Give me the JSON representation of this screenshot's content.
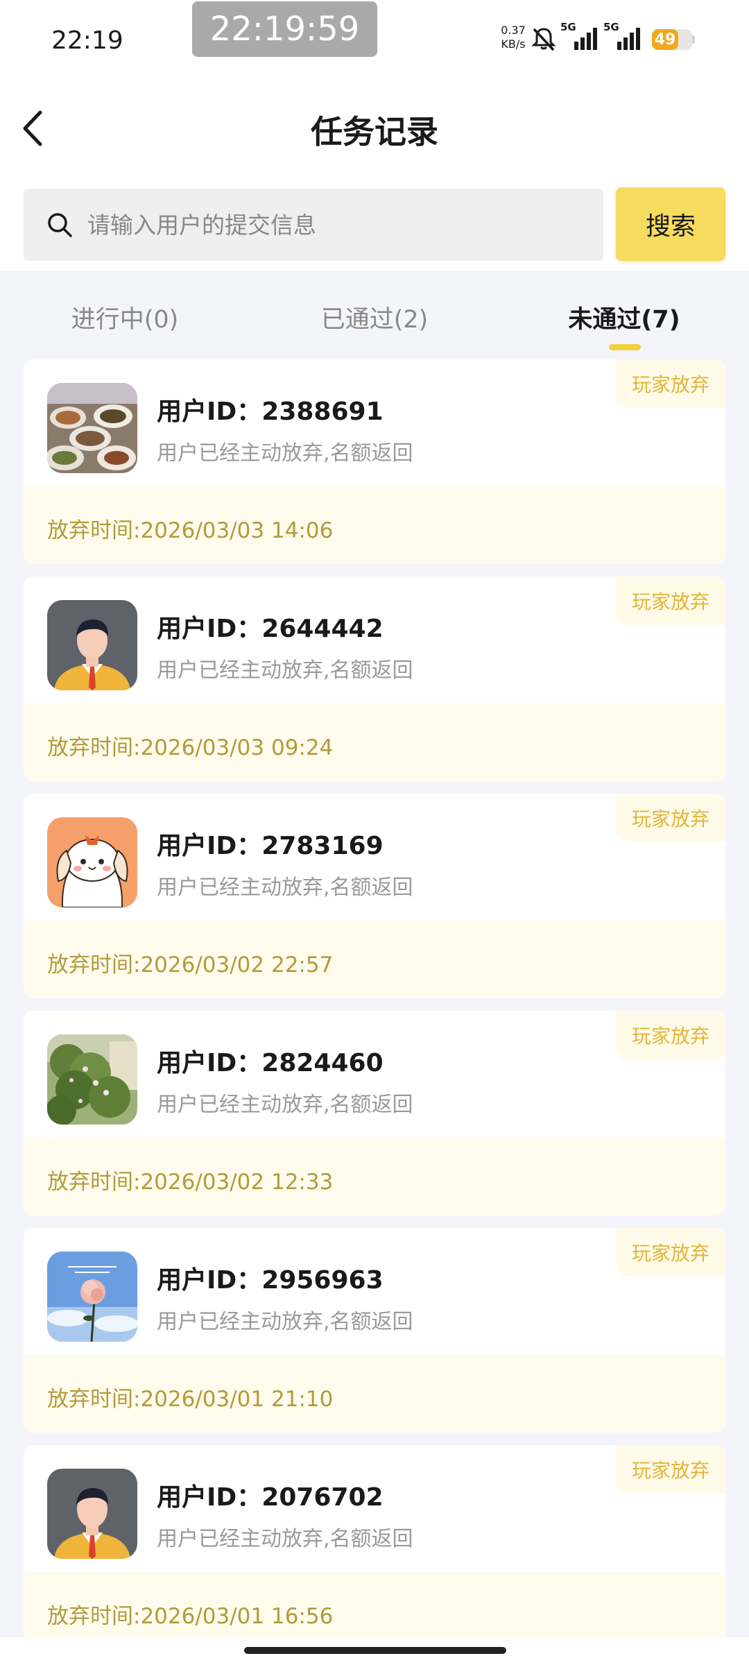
{
  "status_bar": {
    "time": "22:19",
    "clock_overlay": "22:19:59",
    "net_speed_value": "0.37",
    "net_speed_unit": "KB/s",
    "signal_1_label": "5G",
    "signal_2_label": "5G",
    "battery_level": "49",
    "battery_fraction": 0.49,
    "battery_color": "#f2a81c"
  },
  "header": {
    "title": "任务记录",
    "back_icon": "chevron-left-icon"
  },
  "search": {
    "placeholder": "请输入用户的提交信息",
    "value": "",
    "button_label": "搜索",
    "button_color": "#f6dc5f"
  },
  "tabs": [
    {
      "label": "进行中(0)",
      "active": false
    },
    {
      "label": "已通过(2)",
      "active": false
    },
    {
      "label": "未通过(7)",
      "active": true
    }
  ],
  "accent_color": "#f2cf3f",
  "records": [
    {
      "avatar": "food-photo-avatar",
      "user_id": "用户ID：2388691",
      "description": "用户已经主动放弃,名额返回",
      "badge": "玩家放弃",
      "time": "放弃时间:2026/03/03 14:06"
    },
    {
      "avatar": "businessman-avatar",
      "user_id": "用户ID：2644442",
      "description": "用户已经主动放弃,名额返回",
      "badge": "玩家放弃",
      "time": "放弃时间:2026/03/03 09:24"
    },
    {
      "avatar": "cartoon-dog-avatar",
      "user_id": "用户ID：2783169",
      "description": "用户已经主动放弃,名额返回",
      "badge": "玩家放弃",
      "time": "放弃时间:2026/03/02 22:57"
    },
    {
      "avatar": "garden-photo-avatar",
      "user_id": "用户ID：2824460",
      "description": "用户已经主动放弃,名额返回",
      "badge": "玩家放弃",
      "time": "放弃时间:2026/03/02 12:33"
    },
    {
      "avatar": "rose-sky-avatar",
      "user_id": "用户ID：2956963",
      "description": "用户已经主动放弃,名额返回",
      "badge": "玩家放弃",
      "time": "放弃时间:2026/03/01 21:10"
    },
    {
      "avatar": "businessman-avatar",
      "user_id": "用户ID：2076702",
      "description": "用户已经主动放弃,名额返回",
      "badge": "玩家放弃",
      "time": "放弃时间:2026/03/01 16:56"
    }
  ]
}
